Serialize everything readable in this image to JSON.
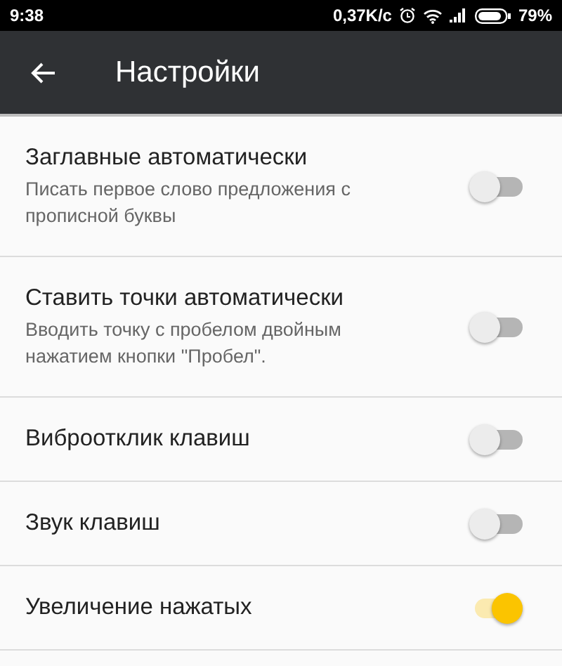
{
  "status_bar": {
    "time": "9:38",
    "speed": "0,37K/c",
    "battery": "79%"
  },
  "toolbar": {
    "title": "Настройки"
  },
  "settings": [
    {
      "title": "Заглавные автоматически",
      "summary": "Писать первое слово предложения с прописной буквы",
      "on": false
    },
    {
      "title": "Ставить точки автоматически",
      "summary": "Вводить точку с пробелом двойным нажатием кнопки \"Пробел\".",
      "on": false
    },
    {
      "title": "Виброотклик клавиш",
      "on": false
    },
    {
      "title": "Звук клавиш",
      "on": false
    },
    {
      "title": "Увеличение нажатых",
      "on": true
    }
  ]
}
